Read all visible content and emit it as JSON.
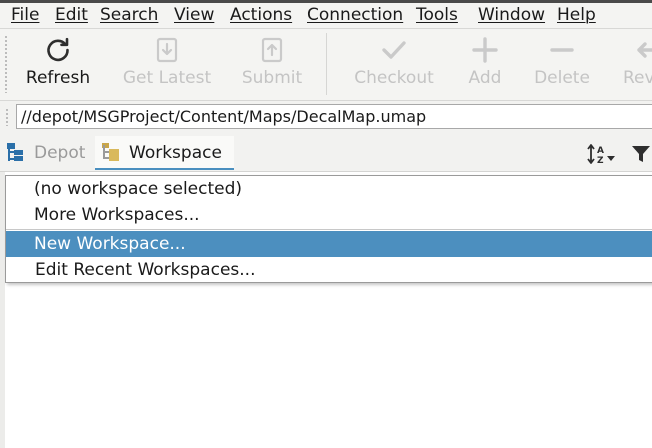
{
  "menu": {
    "items": [
      {
        "label": "File"
      },
      {
        "label": "Edit"
      },
      {
        "label": "Search"
      },
      {
        "label": "View"
      },
      {
        "label": "Actions"
      },
      {
        "label": "Connection"
      },
      {
        "label": "Tools"
      },
      {
        "label": "Window"
      },
      {
        "label": "Help"
      }
    ]
  },
  "toolbar": {
    "refresh_label": "Refresh",
    "get_latest_label": "Get Latest",
    "submit_label": "Submit",
    "checkout_label": "Checkout",
    "add_label": "Add",
    "delete_label": "Delete",
    "revert_label": "Rev",
    "icon_names": {
      "refresh": "refresh-icon",
      "get_latest": "get-latest-icon",
      "submit": "submit-icon",
      "checkout": "checkmark-icon",
      "add": "plus-icon",
      "delete": "minus-icon",
      "revert": "revert-arrow-icon"
    }
  },
  "path": {
    "value": "//depot/MSGProject/Content/Maps/DecalMap.umap"
  },
  "tabs": {
    "depot_label": "Depot",
    "workspace_label": "Workspace",
    "active": "Workspace",
    "icon_names": {
      "depot": "depot-tree-icon",
      "workspace": "workspace-folder-icon",
      "sort": "sort-az-icon",
      "filter": "filter-funnel-icon"
    }
  },
  "dropdown": {
    "items": [
      {
        "label": "(no workspace selected)"
      },
      {
        "label": "More Workspaces..."
      },
      {
        "label": "New Workspace..."
      },
      {
        "label": "Edit Recent Workspaces..."
      }
    ],
    "highlighted": "New Workspace..."
  },
  "colors": {
    "highlight": "#4c8fbf",
    "tab_underline": "#4a8fbf",
    "disabled_text": "#c4c4c4",
    "depot_icon": "#2a6fa8",
    "workspace_icon": "#c9a64a"
  }
}
